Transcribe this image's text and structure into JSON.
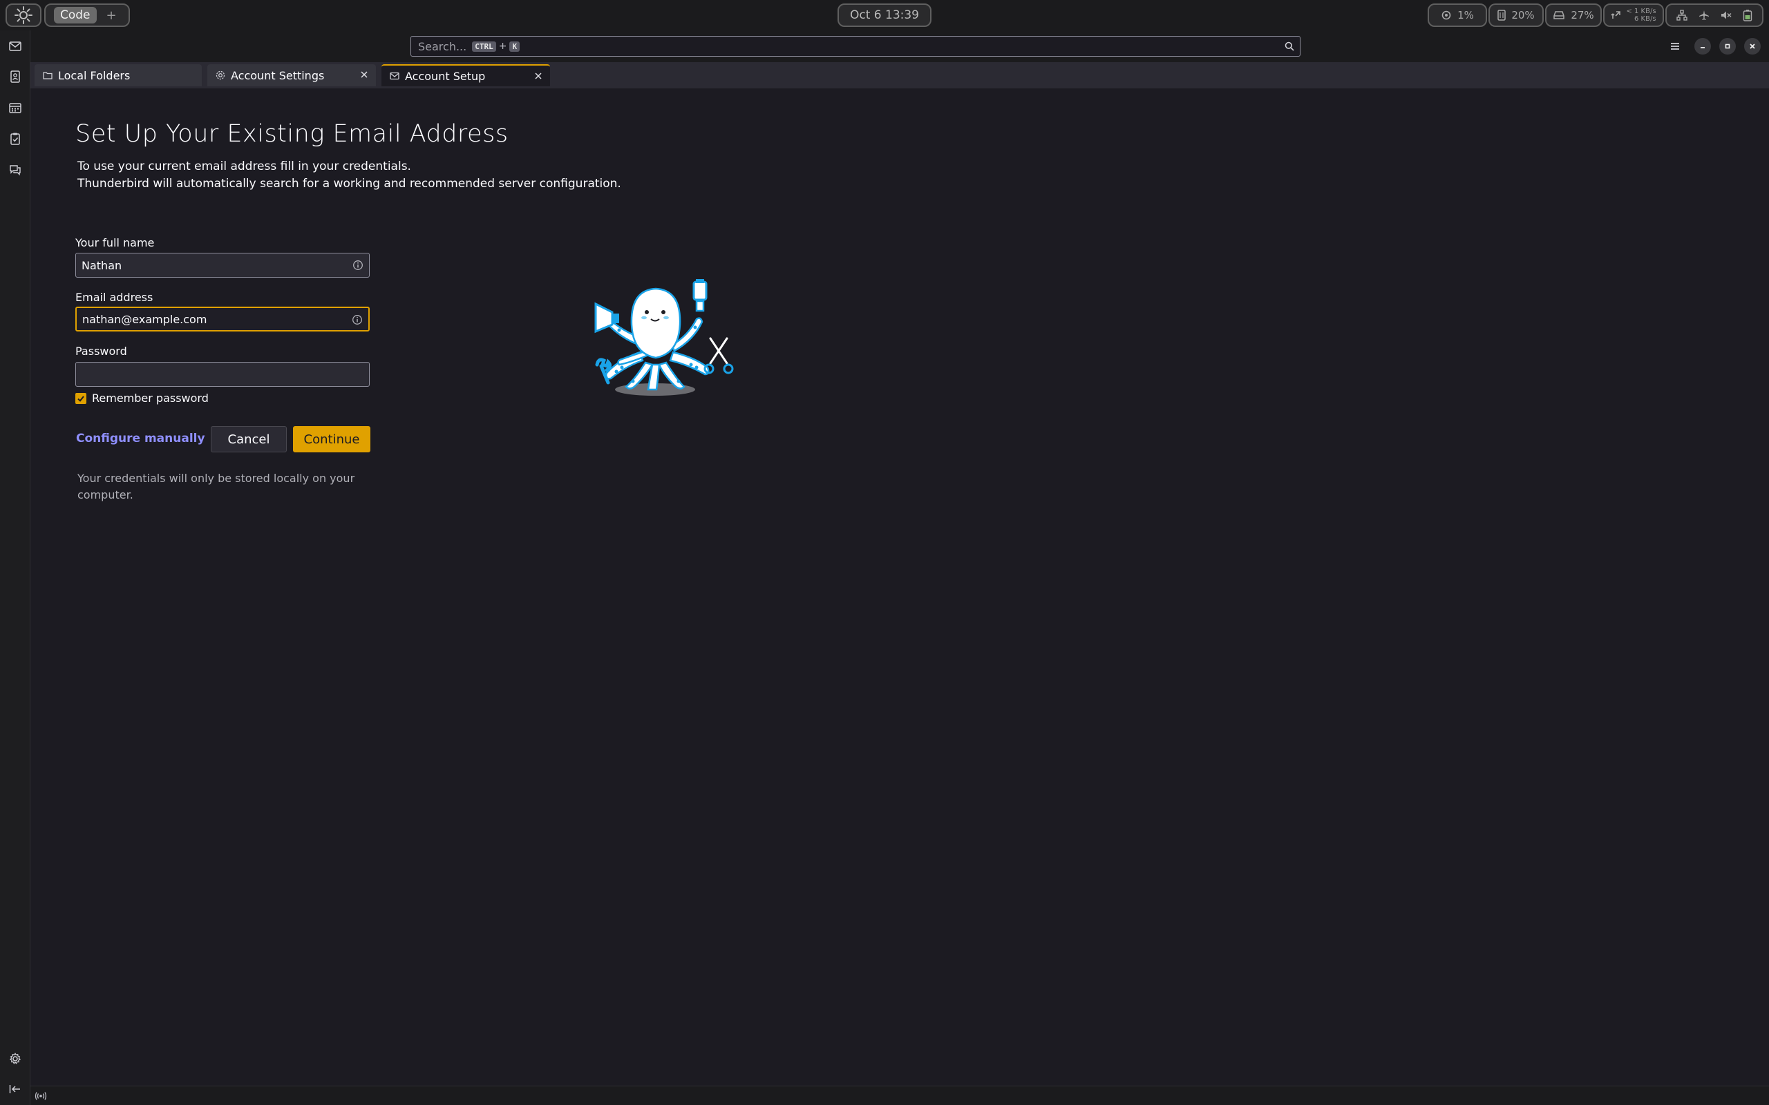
{
  "topbar": {
    "workspace_active": "Code",
    "workspace_add": "+",
    "clock": "Oct 6  13:39",
    "cpu": "1%",
    "memory": "20%",
    "disk": "27%",
    "net_up": "< 1 KB/s",
    "net_down": "6 KB/s"
  },
  "search": {
    "placeholder": "Search...",
    "shortcut_key1": "CTRL",
    "shortcut_plus": "+",
    "shortcut_key2": "K"
  },
  "tabs": [
    {
      "label": "Local Folders",
      "icon": "folder-icon",
      "active": false
    },
    {
      "label": "Account Settings",
      "icon": "gear-icon",
      "active": false
    },
    {
      "label": "Account Setup",
      "icon": "envelope-icon",
      "active": true
    }
  ],
  "setup": {
    "title": "Set Up Your Existing Email Address",
    "intro_line1": "To use your current email address fill in your credentials.",
    "intro_line2": "Thunderbird will automatically search for a working and recommended server configuration.",
    "name_label": "Your full name",
    "name_value": "Nathan",
    "email_label": "Email address",
    "email_value": "nathan@example.com",
    "password_label": "Password",
    "password_value": "",
    "remember_label": "Remember password",
    "remember_checked": true,
    "configure_manually": "Configure manually",
    "cancel": "Cancel",
    "continue": "Continue",
    "credentials_note": "Your credentials will only be stored locally on your computer."
  },
  "colors": {
    "accent": "#e0a100",
    "link": "#8f8fff",
    "background": "#1c1b22",
    "mascot_blue": "#1aa3e8"
  }
}
